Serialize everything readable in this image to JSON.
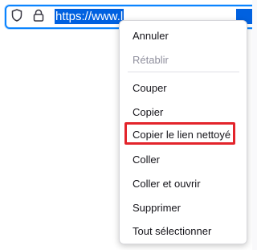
{
  "urlbar": {
    "url_text": "https://www.l",
    "icons": {
      "tracking": "shield-icon",
      "security": "lock-icon"
    },
    "accent_color": "#0a84ff",
    "selection_color": "#0061e0"
  },
  "context_menu": {
    "items": [
      {
        "label": "Annuler",
        "enabled": true
      },
      {
        "label": "Rétablir",
        "enabled": false
      },
      {
        "label": "Couper",
        "enabled": true
      },
      {
        "label": "Copier",
        "enabled": true
      },
      {
        "label": "Copier le lien nettoyé",
        "enabled": true,
        "highlighted": true
      },
      {
        "label": "Coller",
        "enabled": true
      },
      {
        "label": "Coller et ouvrir",
        "enabled": true
      },
      {
        "label": "Supprimer",
        "enabled": true
      },
      {
        "label": "Tout sélectionner",
        "enabled": true
      }
    ],
    "highlight_color": "#e3242b"
  }
}
